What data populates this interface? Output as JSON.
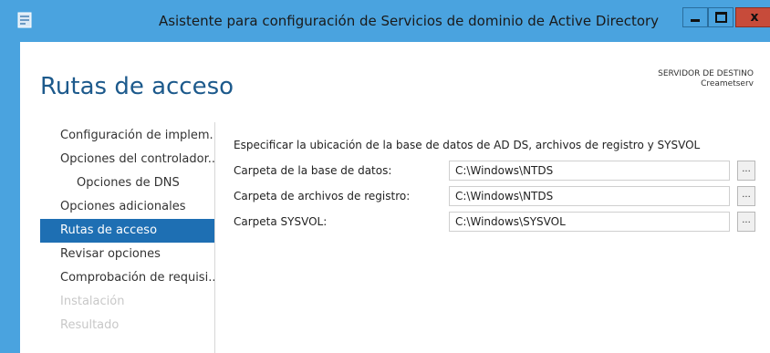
{
  "window": {
    "title": "Asistente para configuración de Servicios de dominio de Active Directory",
    "close_symbol": "x"
  },
  "header": {
    "page_title": "Rutas de acceso",
    "target_server_label": "SERVIDOR DE DESTINO",
    "target_server_name": "Creametserv"
  },
  "nav": {
    "items": [
      {
        "label": "Configuración de implem..."
      },
      {
        "label": "Opciones del controlador..."
      },
      {
        "label": "Opciones de DNS"
      },
      {
        "label": "Opciones adicionales"
      },
      {
        "label": "Rutas de acceso"
      },
      {
        "label": "Revisar opciones"
      },
      {
        "label": "Comprobación de requisi..."
      },
      {
        "label": "Instalación"
      },
      {
        "label": "Resultado"
      }
    ]
  },
  "main": {
    "description": "Especificar la ubicación de la base de datos de AD DS, archivos de registro y SYSVOL",
    "rows": [
      {
        "label": "Carpeta de la base de datos:",
        "value": "C:\\Windows\\NTDS",
        "browse": "..."
      },
      {
        "label": "Carpeta de archivos de registro:",
        "value": "C:\\Windows\\NTDS",
        "browse": "..."
      },
      {
        "label": "Carpeta SYSVOL:",
        "value": "C:\\Windows\\SYSVOL",
        "browse": "..."
      }
    ]
  },
  "colors": {
    "accent": "#1e6fb3",
    "titlebar": "#4aa3df",
    "close_button": "#c74b3a",
    "heading": "#1d5a8c"
  }
}
